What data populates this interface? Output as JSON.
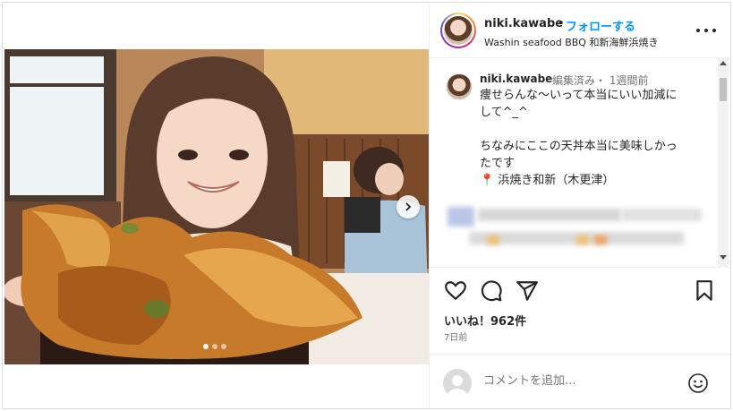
{
  "post": {
    "username": "niki.kawabe",
    "separator": "•",
    "follow_label": "フォローする",
    "location": "Washin seafood BBQ 和新海鮮浜焼き",
    "media_dots": 3,
    "media_active_dot": 1
  },
  "caption": {
    "username": "niki.kawabe",
    "meta": "編集済み・ 1週間前",
    "line1": "痩せらんな〜いって本当にいい加減に",
    "line2": "して^_^",
    "line3": "ちなみにここの天丼本当に美味しかっ",
    "line4": "たです",
    "pin_icon": "📍",
    "line5": "浜焼き和新（木更津）"
  },
  "stats": {
    "likes": "いいね！962件",
    "date": "7日前"
  },
  "comment_box": {
    "placeholder": "コメントを追加..."
  },
  "colors": {
    "follow": "#0095f6",
    "text": "#262626",
    "muted": "#737373",
    "border": "#dbdbdb"
  },
  "icons": [
    "heart-icon",
    "comment-icon",
    "share-icon",
    "bookmark-icon",
    "more-icon",
    "emoji-icon",
    "chevron-right-icon",
    "pin-icon"
  ]
}
